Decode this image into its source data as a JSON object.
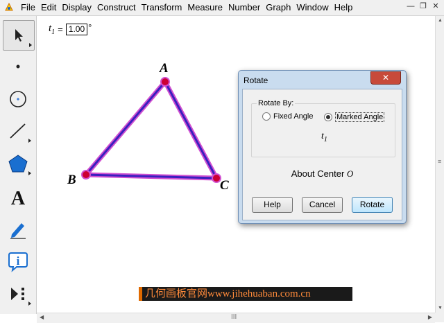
{
  "menubar": {
    "items": [
      "File",
      "Edit",
      "Display",
      "Construct",
      "Transform",
      "Measure",
      "Number",
      "Graph",
      "Window",
      "Help"
    ]
  },
  "window_controls": [
    "minimize-icon",
    "restore-icon",
    "close-icon"
  ],
  "toolbar": {
    "tools": [
      "arrow-select-icon",
      "point-icon",
      "compass-icon",
      "straightedge-icon",
      "polygon-icon",
      "text-tool-icon",
      "marker-icon",
      "information-icon",
      "custom-tool-icon"
    ]
  },
  "parameter": {
    "name": "t",
    "subscript": "1",
    "equals": "=",
    "value": "1.00",
    "unit": "°"
  },
  "triangle": {
    "labels": {
      "a": "A",
      "b": "B",
      "c": "C"
    },
    "edge_color": "#3a1fbf",
    "highlight_color": "#d050d0",
    "point_color": "#cc0033"
  },
  "dialog": {
    "title": "Rotate",
    "close_label": "✕",
    "group_label": "Rotate By:",
    "options": [
      {
        "label": "Fixed Angle",
        "selected": false
      },
      {
        "label": "Marked Angle",
        "selected": true
      }
    ],
    "angle_name": "t",
    "angle_sub": "1",
    "about_text": "About Center",
    "center_name": "O",
    "buttons": {
      "help": "Help",
      "cancel": "Cancel",
      "rotate": "Rotate"
    }
  },
  "watermark": "几何画板官网www.jihehuaban.com.cn",
  "hscroll_thumb": "III"
}
